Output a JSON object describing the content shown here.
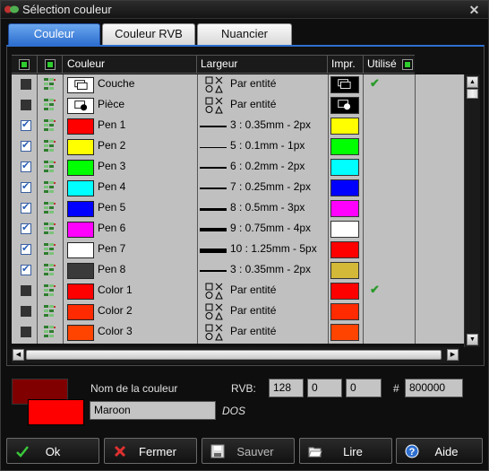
{
  "window": {
    "title": "Sélection couleur",
    "close": "✕"
  },
  "tabs": [
    {
      "label": "Couleur"
    },
    {
      "label": "Couleur RVB"
    },
    {
      "label": "Nuancier"
    }
  ],
  "columns": {
    "color": "Couleur",
    "width": "Largeur",
    "print": "Impr.",
    "used": "Utilisé"
  },
  "rows": [
    {
      "checked": false,
      "swatch": "icon-couche",
      "name": "Couche",
      "width_text": "Par entité",
      "width_icon": true,
      "line": 0,
      "print": "icon-couche",
      "used": true
    },
    {
      "checked": false,
      "swatch": "icon-piece",
      "name": "Pièce",
      "width_text": "Par entité",
      "width_icon": true,
      "line": 0,
      "print": "icon-piece",
      "used": false
    },
    {
      "checked": true,
      "swatch": "#ff0000",
      "name": "Pen 1",
      "width_text": "3 : 0.35mm - 2px",
      "width_icon": false,
      "line": 2,
      "print": "#ffff00",
      "used": false
    },
    {
      "checked": true,
      "swatch": "#ffff00",
      "name": "Pen 2",
      "width_text": "5 : 0.1mm - 1px",
      "width_icon": false,
      "line": 1,
      "print": "#00ff00",
      "used": false
    },
    {
      "checked": true,
      "swatch": "#00ff00",
      "name": "Pen 3",
      "width_text": "6 : 0.2mm - 2px",
      "width_icon": false,
      "line": 2,
      "print": "#00ffff",
      "used": false
    },
    {
      "checked": true,
      "swatch": "#00ffff",
      "name": "Pen 4",
      "width_text": "7 : 0.25mm - 2px",
      "width_icon": false,
      "line": 2,
      "print": "#0000ff",
      "used": false
    },
    {
      "checked": true,
      "swatch": "#0000ff",
      "name": "Pen 5",
      "width_text": "8 : 0.5mm - 3px",
      "width_icon": false,
      "line": 3,
      "print": "#ff00ff",
      "used": false
    },
    {
      "checked": true,
      "swatch": "#ff00ff",
      "name": "Pen 6",
      "width_text": "9 : 0.75mm - 4px",
      "width_icon": false,
      "line": 4,
      "print": "#ffffff",
      "used": false
    },
    {
      "checked": true,
      "swatch": "#ffffff",
      "name": "Pen 7",
      "width_text": "10 : 1.25mm - 5px",
      "width_icon": false,
      "line": 5,
      "print": "#ff0000",
      "used": false
    },
    {
      "checked": true,
      "swatch": "#3a3a3a",
      "name": "Pen 8",
      "width_text": "3 : 0.35mm - 2px",
      "width_icon": false,
      "line": 2,
      "print": "#d4b838",
      "used": false
    },
    {
      "checked": false,
      "swatch": "#ff0000",
      "name": "Color 1",
      "width_text": "Par entité",
      "width_icon": true,
      "line": 0,
      "print": "#ff0000",
      "used": true
    },
    {
      "checked": false,
      "swatch": "#ff2a00",
      "name": "Color 2",
      "width_text": "Par entité",
      "width_icon": true,
      "line": 0,
      "print": "#ff2a00",
      "used": false
    },
    {
      "checked": false,
      "swatch": "#ff4400",
      "name": "Color 3",
      "width_text": "Par entité",
      "width_icon": true,
      "line": 0,
      "print": "#ff4400",
      "used": false
    }
  ],
  "color_info": {
    "name_label": "Nom de la couleur",
    "name_value": "Maroon",
    "source": "DOS",
    "rvb_label": "RVB:",
    "r": "128",
    "g": "0",
    "b": "0",
    "hash_label": "#",
    "hex": "800000",
    "current_color": "#800000",
    "previous_color": "#ff0000"
  },
  "buttons": {
    "ok": "Ok",
    "close": "Fermer",
    "save": "Sauver",
    "read": "Lire",
    "help": "Aide"
  },
  "checkmark": "✔"
}
